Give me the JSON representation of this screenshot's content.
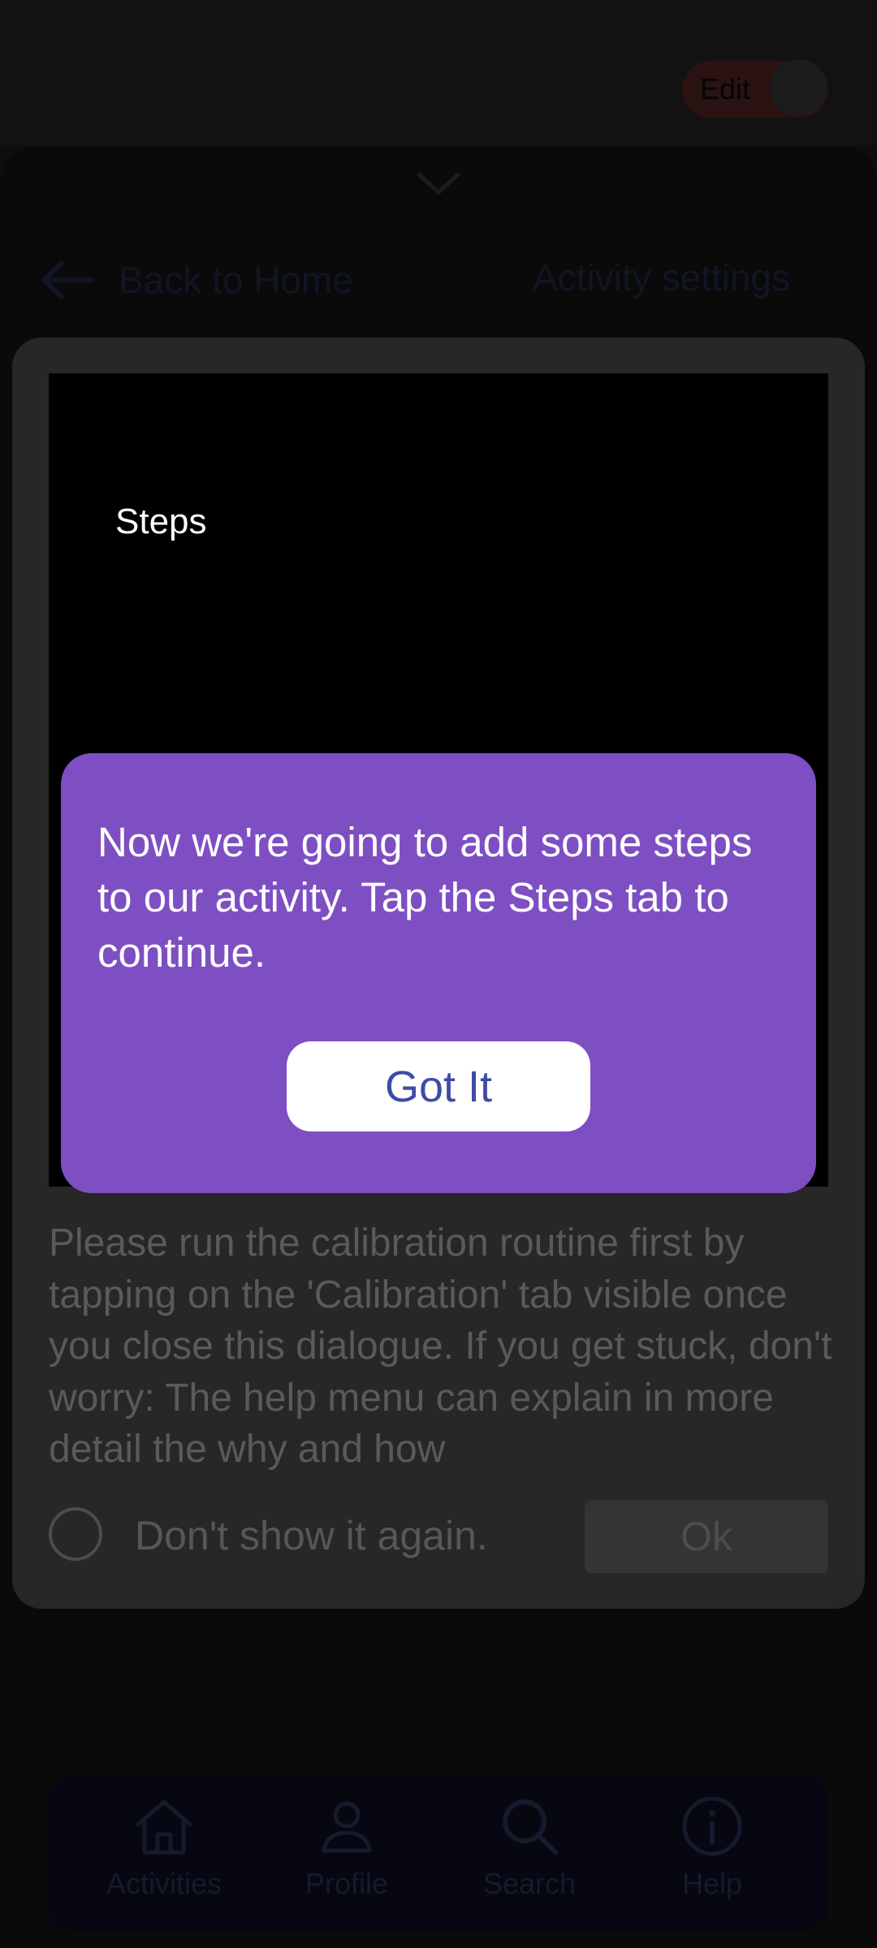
{
  "header": {
    "edit_label": "Edit"
  },
  "sheet": {
    "back_label": "Back to Home",
    "settings_label": "Activity settings"
  },
  "dialog": {
    "video_label": "Steps",
    "message": "Please run the calibration routine first by tapping on the 'Calibration' tab visible once you close this dialogue. If you get stuck, don't worry: The help menu can explain in more detail the why and how",
    "dont_show_label": "Don't show it again.",
    "ok_label": "Ok"
  },
  "tip": {
    "text": "Now we're going to add some steps to our activity. Tap the Steps tab to continue.",
    "button_label": "Got It"
  },
  "nav": {
    "items": [
      {
        "label": "Activities",
        "icon": "home-icon"
      },
      {
        "label": "Profile",
        "icon": "person-icon"
      },
      {
        "label": "Search",
        "icon": "search-icon"
      },
      {
        "label": "Help",
        "icon": "info-icon"
      }
    ]
  },
  "colors": {
    "tip_background": "#7e4fc3",
    "tip_button_text": "#3e4ba6",
    "dialog_background": "#272727"
  }
}
